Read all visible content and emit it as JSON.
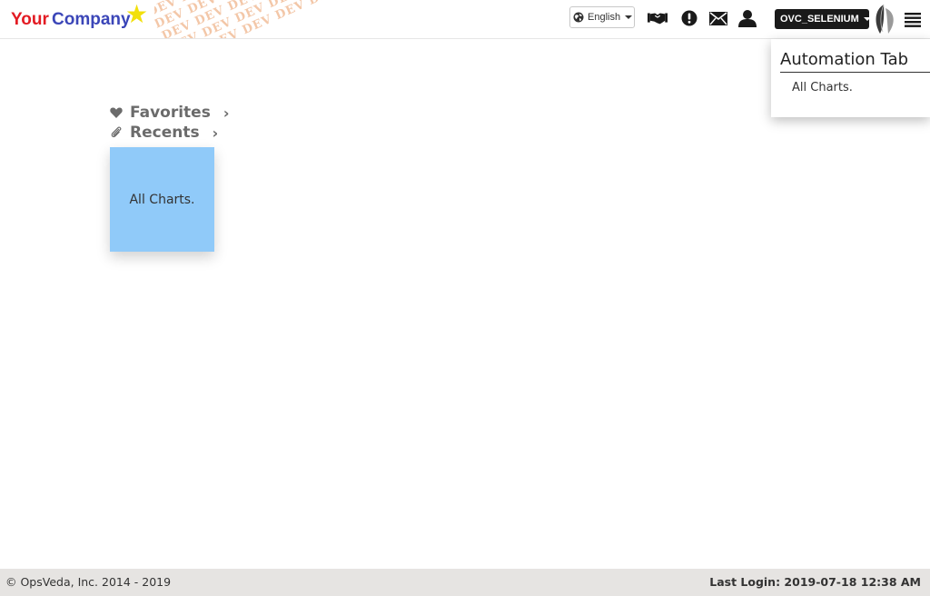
{
  "header": {
    "logo": {
      "part1": "Your",
      "part2": "Company",
      "star": "★",
      "colors": {
        "part1": "#e31b23",
        "part2": "#3b46b8",
        "star": "#f2e00c"
      }
    },
    "watermark_text": "DEV",
    "language": {
      "selected": "English"
    },
    "icons": [
      "handshake-icon",
      "alert-icon",
      "envelope-icon",
      "user-icon",
      "leaf-logo-icon",
      "hamburger-menu-icon"
    ],
    "user_menu": {
      "label": "OVC_SELENIUM"
    }
  },
  "sidenav": {
    "favorites": {
      "label": "Favorites",
      "icon": "heart-icon"
    },
    "recents": {
      "label": "Recents",
      "icon": "paperclip-icon"
    },
    "tile": {
      "label": "All Charts.",
      "color": "#90caf9"
    }
  },
  "dropdown_panel": {
    "title": "Automation Tab",
    "items": [
      {
        "label": "All Charts."
      }
    ]
  },
  "footer": {
    "copyright": "© OpsVeda, Inc. 2014 - 2019",
    "last_login": "Last Login: 2019-07-18 12:38 AM"
  }
}
